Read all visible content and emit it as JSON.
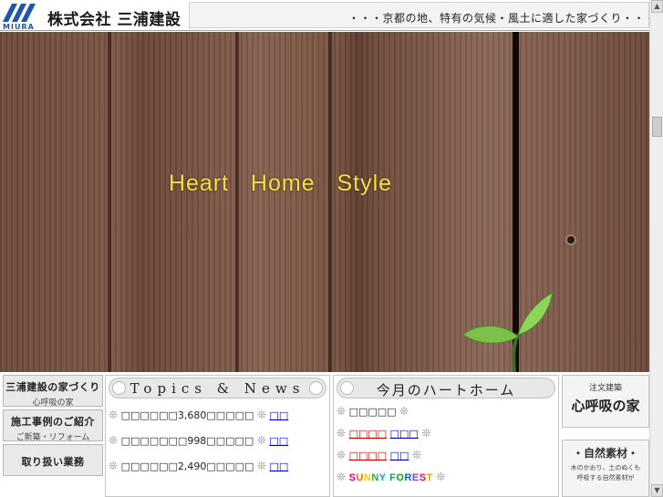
{
  "header": {
    "logo_text": "MIURA",
    "company_name": "株式会社 三浦建設",
    "tagline": "・・・京都の地、特有の気候・風土に適した家づくり・・・"
  },
  "hero": {
    "title_words": [
      "Heart",
      "Home",
      "Style"
    ]
  },
  "nav": {
    "items": [
      {
        "label": "三浦建設の家づくり",
        "sub": "心呼吸の家"
      },
      {
        "label": "施工事例のご紹介",
        "sub": "ご新築・リフォーム"
      },
      {
        "label": "取り扱い業務",
        "sub": ""
      }
    ]
  },
  "topics": {
    "title": "Topics & News",
    "items": [
      {
        "text": "□□□□□□3,680□□□□□",
        "link": "□□"
      },
      {
        "text": "□□□□□□□998□□□□□",
        "link": "□□"
      },
      {
        "text": "□□□□□□2,490□□□□□",
        "link": "□□"
      }
    ]
  },
  "monthly": {
    "title": "今月のハートホーム",
    "items": [
      {
        "text": "□□□□□",
        "link": ""
      },
      {
        "text": "",
        "link_red": "□□□□",
        "link": "□□□"
      },
      {
        "text": "",
        "link_red": "□□□□",
        "link": "□□"
      }
    ],
    "sunny_forest": {
      "letters": [
        "S",
        "U",
        "N",
        "N",
        "Y",
        " ",
        "F",
        "O",
        "R",
        "E",
        "S",
        "T"
      ],
      "colors": [
        "#e5007f",
        "#ff6600",
        "#ffcc00",
        "#33aa33",
        "#0099ff",
        "#ffffff",
        "#00aa66",
        "#00aa00",
        "#0066cc",
        "#9933cc",
        "#ff0066",
        "#ff9900"
      ]
    }
  },
  "right": {
    "box1_small": "注文建築",
    "box1_big": "心呼吸の家",
    "box2_title": "・自然素材・",
    "box2_line1": "木のかおり、土のぬくも",
    "box2_line2": "呼吸する自然素材が"
  },
  "colors": {
    "logo_blue": "#1e56a8",
    "link_blue": "#0000cc",
    "link_red": "#cc0000",
    "hero_title": "#f2e04a"
  }
}
